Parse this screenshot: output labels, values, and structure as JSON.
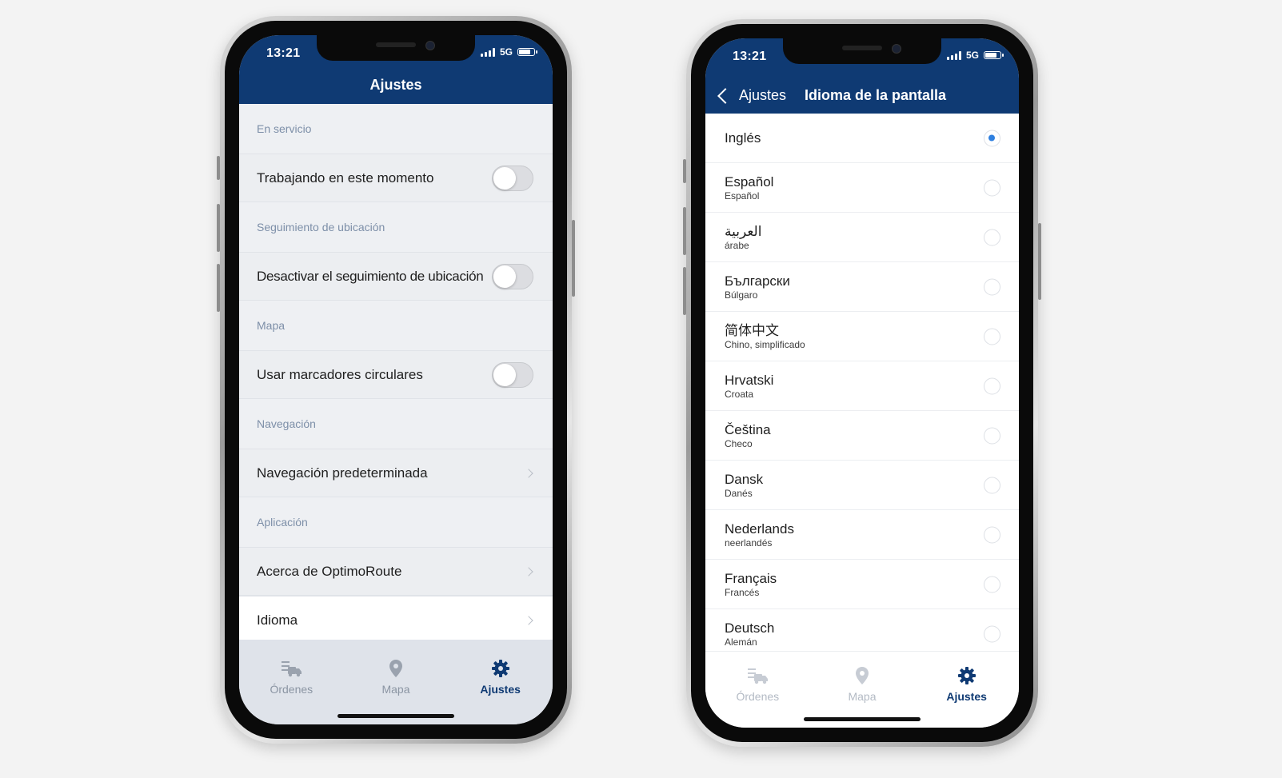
{
  "left_phone": {
    "status": {
      "time": "13:21",
      "network": "5G"
    },
    "title": "Ajustes",
    "sections": [
      {
        "header": "En servicio",
        "row": {
          "label": "Trabajando en este momento",
          "control": "toggle",
          "on": false
        }
      },
      {
        "header": "Seguimiento de ubicación",
        "row": {
          "label": "Desactivar el seguimiento de ubicación",
          "control": "toggle",
          "on": false
        }
      },
      {
        "header": "Mapa",
        "row": {
          "label": "Usar marcadores circulares",
          "control": "toggle",
          "on": false
        }
      },
      {
        "header": "Navegación",
        "row": {
          "label": "Navegación predeterminada",
          "control": "chevron"
        }
      },
      {
        "header": "Aplicación",
        "rows": [
          {
            "label": "Acerca de OptimoRoute",
            "control": "chevron"
          },
          {
            "label": "Idioma",
            "control": "chevron"
          }
        ]
      }
    ],
    "tabs": [
      {
        "label": "Órdenes",
        "icon": "orders-icon",
        "active": false
      },
      {
        "label": "Mapa",
        "icon": "map-pin-icon",
        "active": false
      },
      {
        "label": "Ajustes",
        "icon": "gear-icon",
        "active": true
      }
    ]
  },
  "right_phone": {
    "status": {
      "time": "13:21",
      "network": "5G"
    },
    "back_label": "Ajustes",
    "title": "Idioma de la pantalla",
    "languages": [
      {
        "name": "Inglés",
        "sub": "",
        "selected": true
      },
      {
        "name": "Español",
        "sub": "Español",
        "selected": false
      },
      {
        "name": "العربية",
        "sub": "árabe",
        "selected": false
      },
      {
        "name": "Български",
        "sub": "Búlgaro",
        "selected": false
      },
      {
        "name": "简体中文",
        "sub": "Chino, simplificado",
        "selected": false
      },
      {
        "name": "Hrvatski",
        "sub": "Croata",
        "selected": false
      },
      {
        "name": "Čeština",
        "sub": "Checo",
        "selected": false
      },
      {
        "name": "Dansk",
        "sub": "Danés",
        "selected": false
      },
      {
        "name": "Nederlands",
        "sub": "neerlandés",
        "selected": false
      },
      {
        "name": "Français",
        "sub": "Francés",
        "selected": false
      },
      {
        "name": "Deutsch",
        "sub": "Alemán",
        "selected": false
      }
    ],
    "tabs": [
      {
        "label": "Órdenes",
        "icon": "orders-icon",
        "active": false
      },
      {
        "label": "Mapa",
        "icon": "map-pin-icon",
        "active": false
      },
      {
        "label": "Ajustes",
        "icon": "gear-icon",
        "active": true
      }
    ]
  },
  "colors": {
    "navbar": "#0f3a73",
    "accent_blue": "#2f80e0",
    "section_text": "#7d8fa8"
  }
}
